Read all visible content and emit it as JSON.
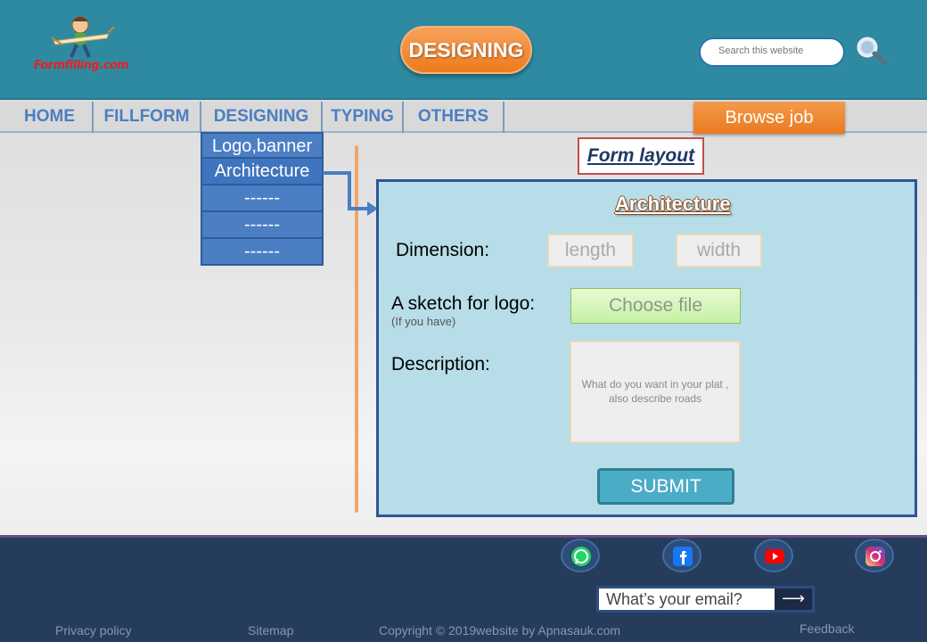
{
  "header": {
    "logo_text": "Formfilling.com",
    "title": "DESIGNING",
    "search_placeholder": "Search this website"
  },
  "nav": {
    "items": [
      "HOME",
      "FILLFORM",
      "DESIGNING",
      "TYPING",
      "OTHERS"
    ],
    "browse_label": "Browse job"
  },
  "dropdown": {
    "items": [
      "Logo,banner",
      "Architecture",
      "------",
      "------",
      "------"
    ],
    "active": "Architecture"
  },
  "form": {
    "section_label": "Form layout",
    "title": "Architecture",
    "dimension_label": "Dimension:",
    "length_placeholder": "length",
    "width_placeholder": "width",
    "sketch_label": "A sketch for logo:",
    "sketch_sublabel": "(If you have)",
    "file_button": "Choose file",
    "description_label": "Description:",
    "description_placeholder": "What do you want in your plat , also describe roads",
    "submit_label": "SUBMIT"
  },
  "footer": {
    "social_icons": [
      "whatsapp-icon",
      "facebook-icon",
      "youtube-icon",
      "instagram-icon"
    ],
    "email_placeholder": "What’s your email?",
    "links": {
      "privacy": "Privacy policy",
      "sitemap": "Sitemap",
      "copyright": "Copyright © 2019website by Apnasauk.com",
      "feedback": "Feedback"
    }
  },
  "colors": {
    "header_bg": "#2e8aa1",
    "accent_orange": "#ee7a1d",
    "nav_text": "#4a7fc1",
    "panel_bg": "#b7dde8",
    "footer_bg": "#253c5c"
  }
}
